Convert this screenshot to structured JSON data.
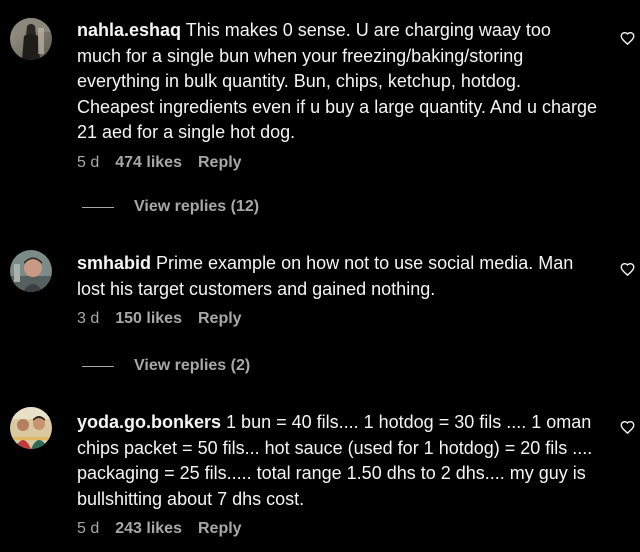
{
  "comments": [
    {
      "username": "nahla.eshaq",
      "text": "This makes 0 sense. U are charging waay too much for a single bun when your freezing/baking/storing everything in bulk quantity. Bun, chips, ketchup, hotdog. Cheapest ingredients even if u buy a large quantity. And u charge 21 aed for a single hot dog.",
      "time": "5 d",
      "likes": "474 likes",
      "reply_label": "Reply",
      "view_replies": "View replies (12)",
      "avatar_icon": "avatar-photo"
    },
    {
      "username": "smhabid",
      "text": "Prime example on how not to use social media. Man lost his target customers and gained nothing.",
      "time": "3 d",
      "likes": "150 likes",
      "reply_label": "Reply",
      "view_replies": "View replies (2)",
      "avatar_icon": "avatar-photo"
    },
    {
      "username": "yoda.go.bonkers",
      "text": "1 bun = 40 fils.... 1 hotdog = 30 fils .... 1 oman chips packet = 50 fils... hot sauce (used for 1 hotdog) = 20 fils .... packaging = 25 fils..... total range 1.50 dhs to 2 dhs.... my guy is bullshitting about 7 dhs cost.",
      "time": "5 d",
      "likes": "243 likes",
      "reply_label": "Reply",
      "avatar_icon": "avatar-photo"
    }
  ],
  "theme": {
    "background": "#000000",
    "text": "#f5f5f5",
    "secondary": "#a8a8a8"
  },
  "icons": {
    "like": "heart-outline-icon"
  }
}
